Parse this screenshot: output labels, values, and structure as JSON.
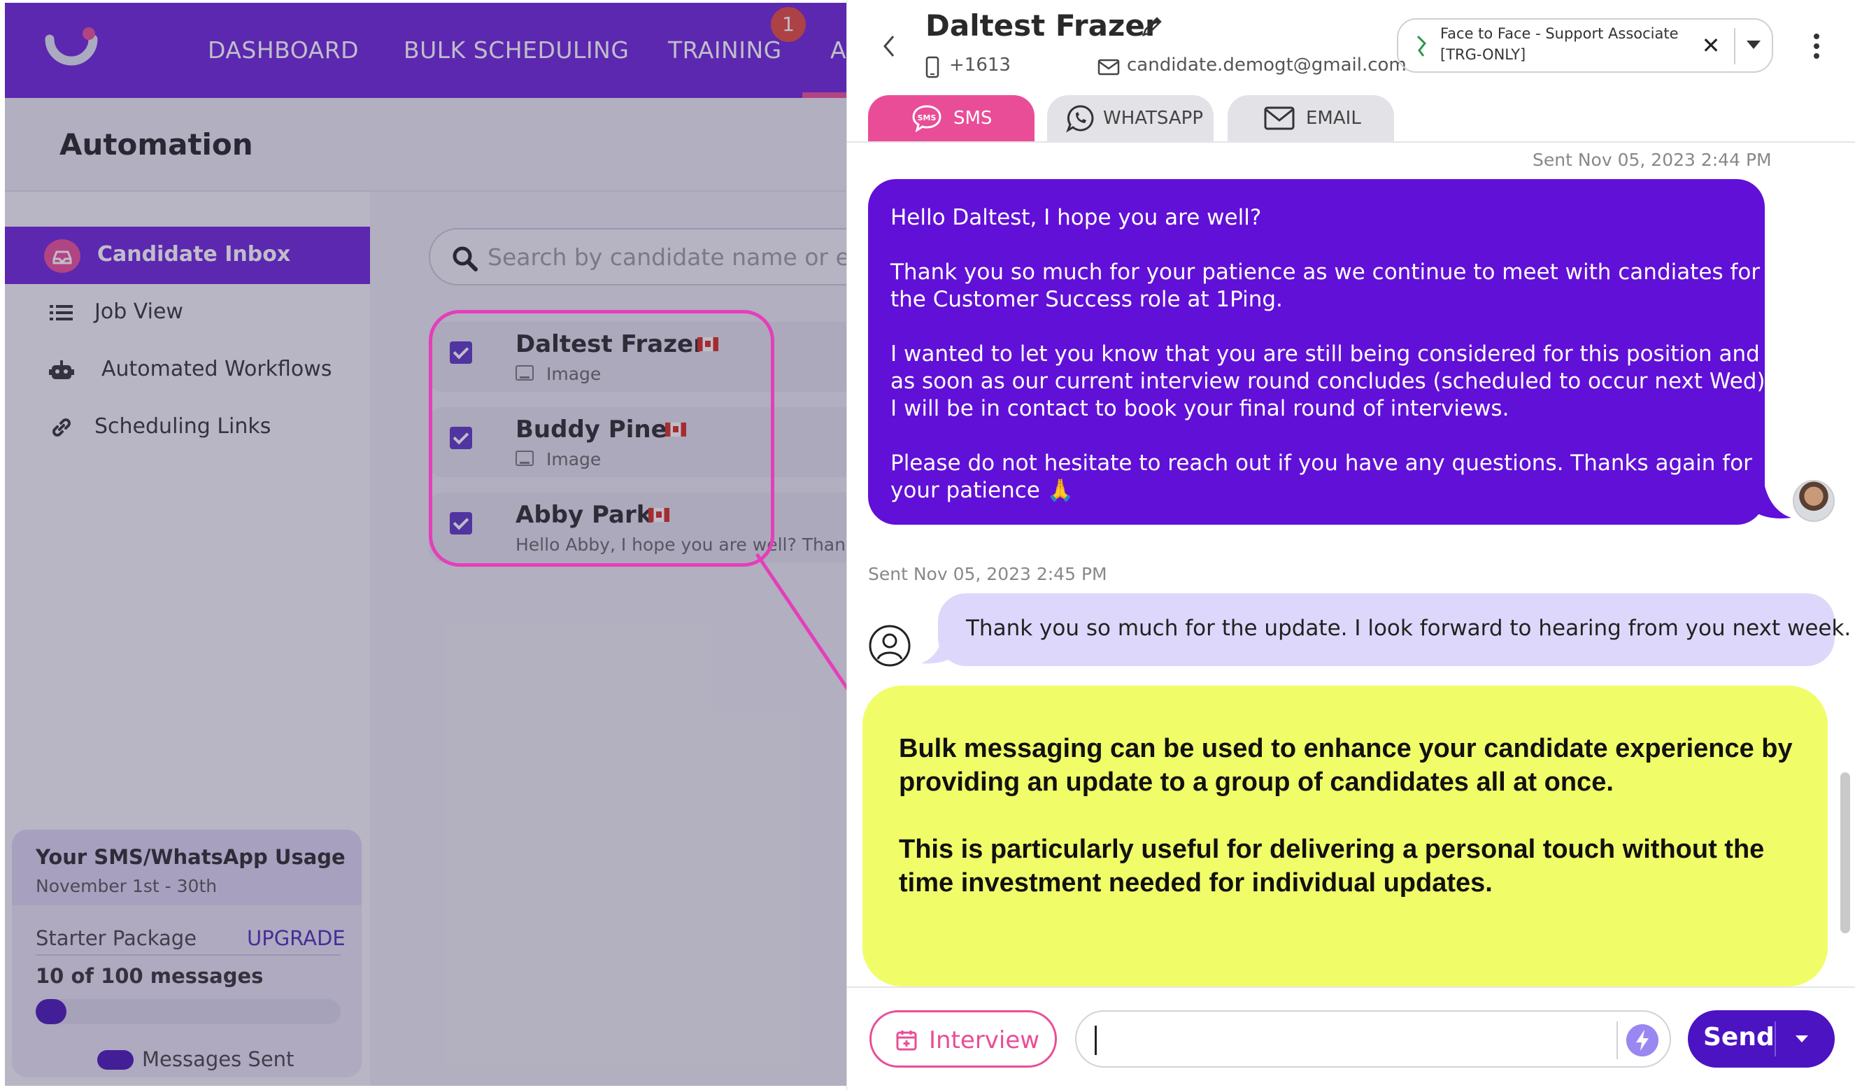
{
  "nav": {
    "items": [
      "DASHBOARD",
      "BULK SCHEDULING",
      "TRAINING",
      "A"
    ],
    "badge": "1"
  },
  "page": {
    "title": "Automation"
  },
  "sidebar": {
    "items": [
      {
        "label": "Candidate Inbox",
        "icon": "inbox-icon"
      },
      {
        "label": "Job View",
        "icon": "list-icon"
      },
      {
        "label": "Automated Workflows",
        "icon": "robot-icon"
      },
      {
        "label": "Scheduling Links",
        "icon": "link-icon"
      }
    ]
  },
  "usage": {
    "title": "Your SMS/WhatsApp Usage",
    "period": "November 1st - 30th",
    "plan": "Starter Package",
    "upgrade": "UPGRADE",
    "count": "10 of 100 messages",
    "progress": 0.1,
    "legend": "Messages Sent"
  },
  "search": {
    "placeholder": "Search by candidate name or ema"
  },
  "candidates": [
    {
      "name": "Daltest Frazer",
      "preview": "Image",
      "has_image": true
    },
    {
      "name": "Buddy Pine",
      "preview": "Image",
      "has_image": true
    },
    {
      "name": "Abby Park",
      "preview": "Hello Abby, I hope you are well? Thank y",
      "has_image": false
    }
  ],
  "candidate": {
    "name": "Daltest Frazer",
    "phone": "+1613",
    "email": "candidate.demogt@gmail.com"
  },
  "job": {
    "line1": "Face to Face - Support Associate",
    "line2": "[TRG-ONLY]",
    "clear": "✕"
  },
  "tabs": [
    {
      "label": "SMS",
      "active": true
    },
    {
      "label": "WHATSAPP",
      "active": false
    },
    {
      "label": "EMAIL",
      "active": false
    }
  ],
  "messages": {
    "outgoing": {
      "timestamp": "Sent Nov 05, 2023 2:44 PM",
      "paragraphs": [
        [
          "Hello Daltest, I hope you are well?"
        ],
        [
          "Thank you so much for your patience as we continue to meet with candiates for",
          "the Customer Success role at 1Ping."
        ],
        [
          "I wanted to let you know that you are still being considered for this position and",
          "as soon as our current interview round concludes (scheduled to occur next Wed),",
          "I will be in contact to book your final round of interviews."
        ],
        [
          "Please do not hesitate to reach out if you have any questions.  Thanks again for",
          "your patience 🙏"
        ]
      ]
    },
    "incoming": {
      "timestamp": "Sent Nov 05, 2023 2:45 PM",
      "text": "Thank you so much for the update.  I look forward to hearing from you next week."
    }
  },
  "callout": {
    "paragraphs": [
      "Bulk messaging can be used to enhance your candidate experience by providing an update to a group of candidates all at once.",
      "This is particularly useful for delivering a personal touch without the time investment needed for individual updates."
    ],
    "color": "#f0fd68"
  },
  "composer": {
    "interview": "Interview",
    "send": "Send"
  },
  "colors": {
    "brand": "#6a24d8",
    "accent": "#e94d97",
    "outgoing_bubble": "#6110d7",
    "incoming_bubble": "#ddd8fb",
    "send_button": "#4b13c2"
  }
}
